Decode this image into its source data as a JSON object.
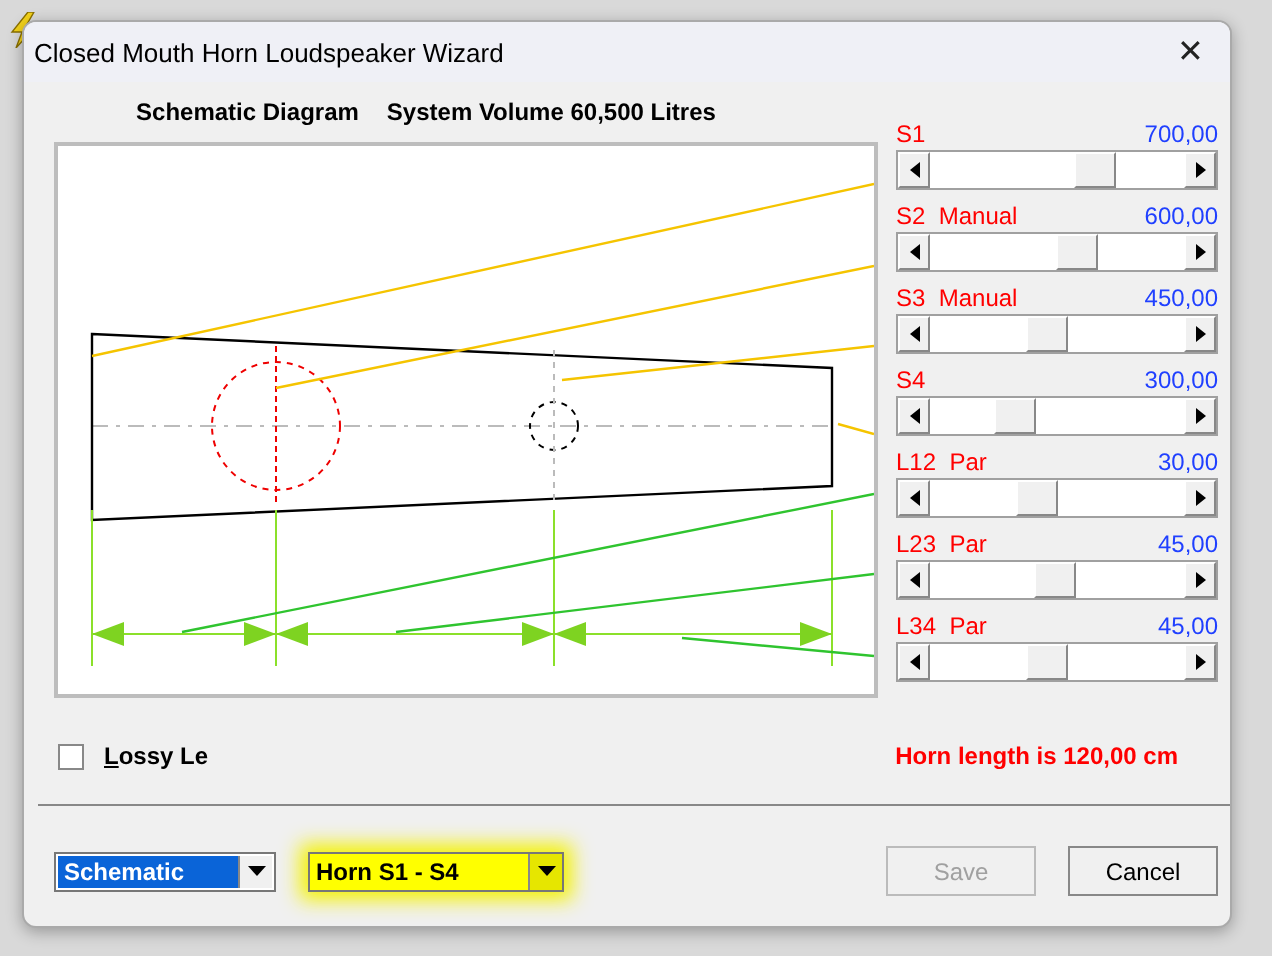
{
  "dialog": {
    "title": "Closed Mouth Horn Loudspeaker Wizard",
    "close": "✕"
  },
  "diagram": {
    "title": "Schematic Diagram",
    "volume": "System Volume 60,500 Litres"
  },
  "parameters": [
    {
      "name": "S1",
      "reading": "700,00",
      "level": 0.68,
      "kind": "area"
    },
    {
      "name": "S2  Manual",
      "reading": "600,00",
      "level": 0.59,
      "kind": "area"
    },
    {
      "name": "S3  Manual",
      "reading": "450,00",
      "level": 0.45,
      "kind": "area"
    },
    {
      "name": "S4",
      "reading": "300,00",
      "level": 0.3,
      "kind": "area"
    },
    {
      "name": "L12  Par",
      "reading": "30,00",
      "level": 0.41,
      "kind": "length"
    },
    {
      "name": "L23  Par",
      "reading": "45,00",
      "level": 0.49,
      "kind": "length"
    },
    {
      "name": "L34  Par",
      "reading": "45,00",
      "level": 0.45,
      "kind": "length"
    }
  ],
  "lossy": {
    "label": "Lossy Le",
    "checked": false
  },
  "horn_length": "Horn length is 120,00 cm",
  "view_combo": {
    "value": "Schematic"
  },
  "horn_combo": {
    "value": "Horn S1 - S4"
  },
  "buttons": [
    {
      "label": "Save",
      "disabled": true
    },
    {
      "label": "Cancel",
      "disabled": false
    }
  ]
}
